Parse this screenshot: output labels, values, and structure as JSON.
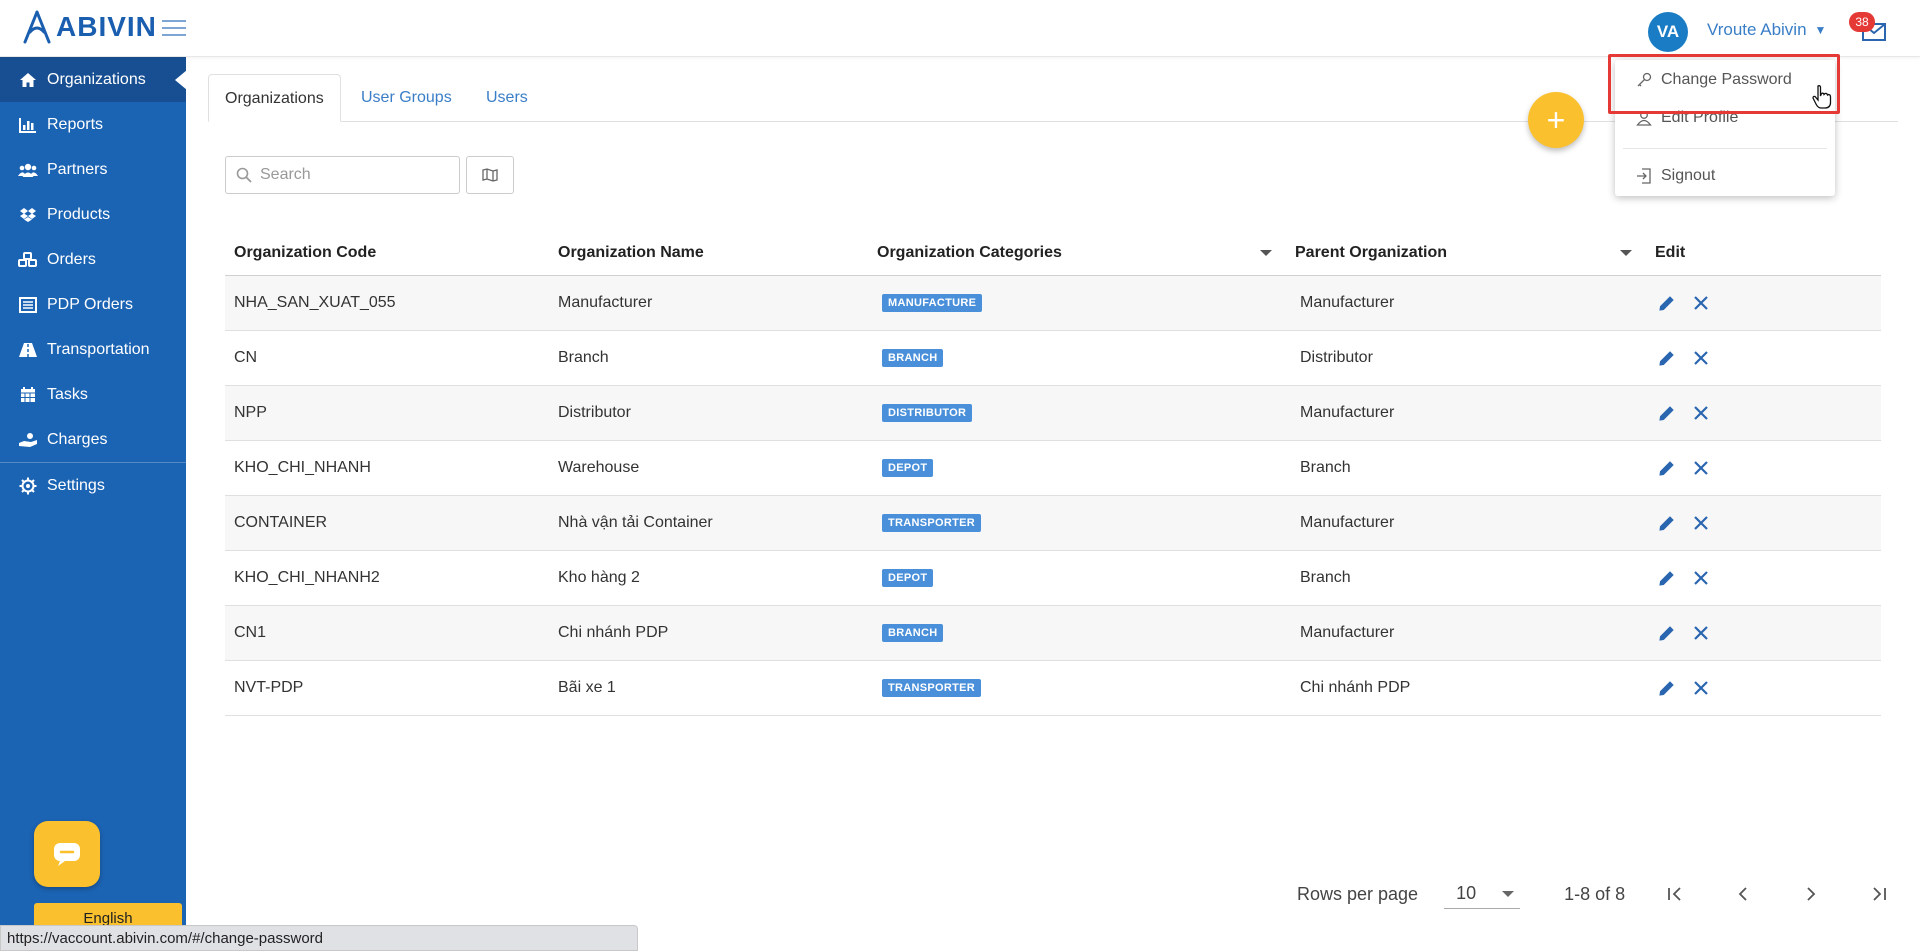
{
  "app": {
    "logo_text": "ABIVIN",
    "user_initials": "VA",
    "user_name": "Vroute Abivin",
    "mail_count": "38",
    "brand_color": "#1b63b3",
    "accent_color": "#fbc02d"
  },
  "sidebar": {
    "items": [
      {
        "label": "Organizations",
        "icon": "home-icon"
      },
      {
        "label": "Reports",
        "icon": "bar-chart-icon"
      },
      {
        "label": "Partners",
        "icon": "users-icon"
      },
      {
        "label": "Products",
        "icon": "boxes-icon"
      },
      {
        "label": "Orders",
        "icon": "cubes-icon"
      },
      {
        "label": "PDP Orders",
        "icon": "list-icon"
      },
      {
        "label": "Transportation",
        "icon": "road-icon"
      },
      {
        "label": "Tasks",
        "icon": "calendar-icon"
      },
      {
        "label": "Charges",
        "icon": "hand-coin-icon"
      },
      {
        "label": "Settings",
        "icon": "gear-icon"
      }
    ],
    "language_label": "English"
  },
  "tabs": [
    {
      "label": "Organizations",
      "active": true
    },
    {
      "label": "User Groups",
      "active": false
    },
    {
      "label": "Users",
      "active": false
    }
  ],
  "search": {
    "placeholder": "Search",
    "value": ""
  },
  "table": {
    "headers": [
      "Organization Code",
      "Organization Name",
      "Organization Categories",
      "Parent Organization",
      "Edit"
    ],
    "rows": [
      {
        "code": "NHA_SAN_XUAT_055",
        "name": "Manufacturer",
        "category": "MANUFACTURE",
        "parent": "Manufacturer"
      },
      {
        "code": "CN",
        "name": "Branch",
        "category": "BRANCH",
        "parent": "Distributor"
      },
      {
        "code": "NPP",
        "name": "Distributor",
        "category": "DISTRIBUTOR",
        "parent": "Manufacturer"
      },
      {
        "code": "KHO_CHI_NHANH",
        "name": "Warehouse",
        "category": "DEPOT",
        "parent": "Branch"
      },
      {
        "code": "CONTAINER",
        "name": "Nhà vận tải Container",
        "category": "TRANSPORTER",
        "parent": "Manufacturer"
      },
      {
        "code": "KHO_CHI_NHANH2",
        "name": "Kho hàng 2",
        "category": "DEPOT",
        "parent": "Branch"
      },
      {
        "code": "CN1",
        "name": "Chi nhánh PDP",
        "category": "BRANCH",
        "parent": "Manufacturer"
      },
      {
        "code": "NVT-PDP",
        "name": "Bãi xe 1",
        "category": "TRANSPORTER",
        "parent": "Chi nhánh PDP"
      }
    ]
  },
  "pagination": {
    "rows_per_page_label": "Rows per page",
    "rows_per_page": "10",
    "range": "1-8 of 8"
  },
  "user_menu": {
    "items": [
      {
        "label": "Change Password",
        "icon": "key-icon"
      },
      {
        "label": "Edit Profile",
        "icon": "user-outline-icon"
      },
      {
        "label": "Signout",
        "icon": "signout-icon"
      }
    ]
  },
  "status_bar": {
    "url": "https://vaccount.abivin.com/#/change-password"
  }
}
